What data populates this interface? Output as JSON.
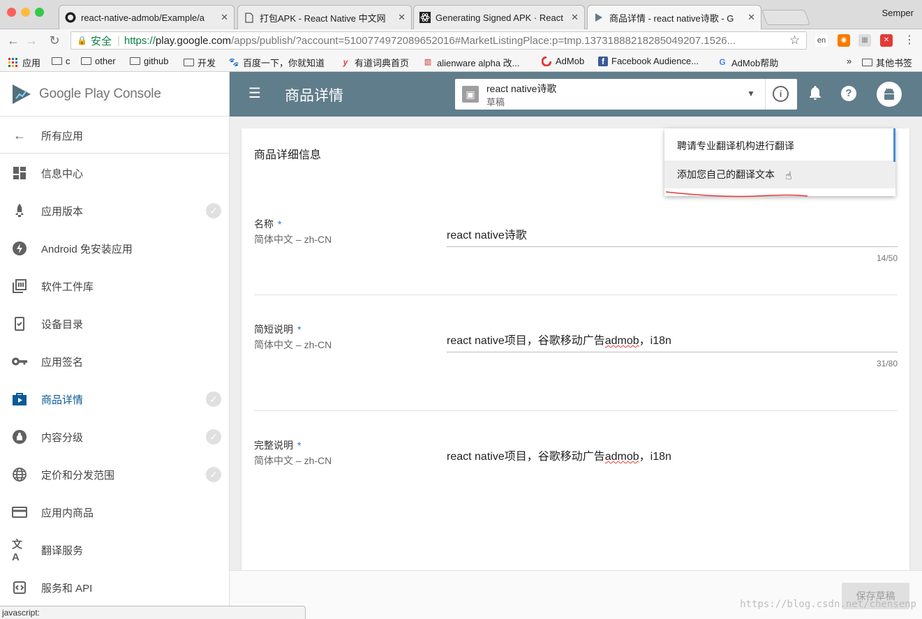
{
  "browser": {
    "tabs": [
      {
        "title": "react-native-admob/Example/a",
        "icon": "github"
      },
      {
        "title": "打包APK - React Native 中文网",
        "icon": "doc"
      },
      {
        "title": "Generating Signed APK · React",
        "icon": "react"
      },
      {
        "title": "商品详情 - react native诗歌 - G",
        "icon": "play"
      }
    ],
    "close_glyph": "✕",
    "profile": "Semper",
    "address": {
      "secure_label": "安全",
      "scheme": "https://",
      "host": "play.google.com",
      "path": "/apps/publish/?account=5100774972089652016#MarketListingPlace:p=tmp.13731888218285049207.1526..."
    },
    "bookmarks": [
      {
        "label": "应用",
        "icon": "apps-grid"
      },
      {
        "label": "c",
        "icon": "folder"
      },
      {
        "label": "other",
        "icon": "folder"
      },
      {
        "label": "github",
        "icon": "folder"
      },
      {
        "label": "开发",
        "icon": "folder"
      },
      {
        "label": "百度一下，你就知道",
        "icon": "baidu-paw"
      },
      {
        "label": "有道词典首页",
        "icon": "youdao"
      },
      {
        "label": "alienware alpha 改...",
        "icon": "alienware"
      },
      {
        "label": "AdMob",
        "icon": "admob"
      },
      {
        "label": "Facebook Audience...",
        "icon": "facebook"
      },
      {
        "label": "AdMob帮助",
        "icon": "google-g"
      }
    ],
    "bookmarks_more": "»",
    "bookmarks_other": "其他书签",
    "status_text": "javascript:"
  },
  "console": {
    "brand": "Google Play Console",
    "page_title": "商品详情",
    "app_selector": {
      "name": "react native诗歌",
      "status": "草稿"
    },
    "back_label": "所有应用",
    "nav": [
      {
        "label": "信息中心",
        "icon": "dashboard",
        "check": false
      },
      {
        "label": "应用版本",
        "icon": "rocket",
        "check": true
      },
      {
        "label": "Android 免安装应用",
        "icon": "bolt",
        "check": false
      },
      {
        "label": "软件工件库",
        "icon": "library",
        "check": false
      },
      {
        "label": "设备目录",
        "icon": "device",
        "check": false
      },
      {
        "label": "应用签名",
        "icon": "key",
        "check": false
      },
      {
        "label": "商品详情",
        "icon": "store",
        "check": true,
        "active": true
      },
      {
        "label": "内容分级",
        "icon": "rating",
        "check": true
      },
      {
        "label": "定价和分发范围",
        "icon": "globe",
        "check": true
      },
      {
        "label": "应用内商品",
        "icon": "card",
        "check": false
      },
      {
        "label": "翻译服务",
        "icon": "translate",
        "check": false
      },
      {
        "label": "服务和 API",
        "icon": "api",
        "check": false
      }
    ],
    "card_title": "商品详细信息",
    "menu": {
      "item1": "聘请专业翻译机构进行翻译",
      "item2": "添加您自己的翻译文本"
    },
    "fields": [
      {
        "label": "名称",
        "required": "*",
        "lang": "简体中文 – zh-CN",
        "value": "react native诗歌",
        "count": "14/50"
      },
      {
        "label": "简短说明",
        "required": "*",
        "lang": "简体中文 – zh-CN",
        "value_pre": "react native项目，谷歌移动广告",
        "value_err": "admob",
        "value_post": "，i18n",
        "count": "31/80"
      },
      {
        "label": "完整说明",
        "required": "*",
        "lang": "简体中文 – zh-CN",
        "value_pre": "react native项目，谷歌移动广告",
        "value_err": "admob",
        "value_post": "，i18n"
      }
    ],
    "save_label": "保存草稿"
  },
  "watermark": "https://blog.csdn.net/chensenp",
  "colors": {
    "appbar": "#607d8b",
    "active_nav": "#0a5a96",
    "secure": "#0b8043",
    "annotation": "#e53935"
  }
}
